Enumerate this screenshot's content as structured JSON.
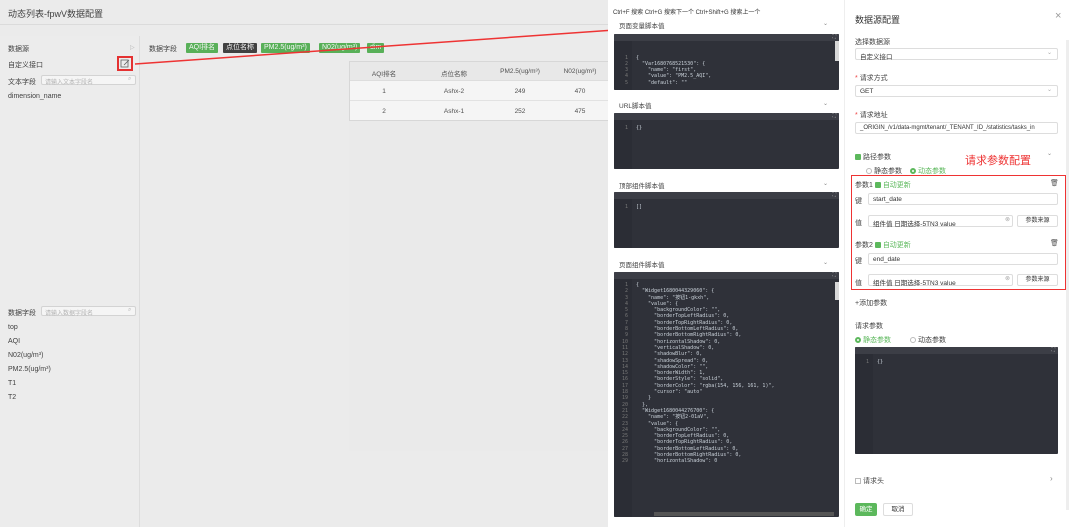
{
  "page": {
    "title": "动态列表-fpwV数据配置"
  },
  "left": {
    "datasource_label": "数据源",
    "datasource_value": "自定义接口",
    "text_field_label": "文本字段",
    "text_field_placeholder": "请输入文本字段名",
    "text_items": [
      "dimension_name"
    ],
    "data_field_label": "数据字段",
    "data_field_placeholder": "请输入数据字段名",
    "data_items": [
      "top",
      "AQI",
      "N02(ug/m³)",
      "PM2.5(ug/m³)",
      "T1",
      "T2"
    ]
  },
  "preview": {
    "data_field_label": "数据字段",
    "tags": [
      {
        "label": "AQI排名",
        "color": "#5cb85c"
      },
      {
        "label": "点位名称",
        "color": "#444444"
      },
      {
        "label": "PM2.5(ug/m³)",
        "color": "#5cb85c"
      },
      {
        "label": "N02(ug/m³)",
        "color": "#5cb85c"
      },
      {
        "label": "dim",
        "color": "#5cb85c"
      }
    ],
    "columns": [
      "AQI排名",
      "点位名称",
      "PM2.5(ug/m³)",
      "N02(ug/m³)"
    ],
    "rows": [
      [
        "1",
        "Ashx-2",
        "249",
        "470"
      ],
      [
        "2",
        "Ashx-1",
        "252",
        "475"
      ]
    ]
  },
  "middle": {
    "hint": "Ctrl+F 搜索 Ctrl+G 搜索下一个 Ctrl+Shift+G 搜索上一个",
    "sec1_title": "页面变量脚本值",
    "sec1_lines": [
      "1",
      "2",
      "3",
      "4",
      "5"
    ],
    "sec1_code": [
      "{",
      "  \"Var1680768521530\": {",
      "    \"name\": \"first\",",
      "    \"value\": \"PM2.5_AQI\",",
      "    \"default\": \"\""
    ],
    "sec2_title": "URL脚本值",
    "sec2_code": "{}",
    "sec3_title": "顶部组件脚本值",
    "sec3_code": "[]",
    "sec4_title": "页面组件脚本值",
    "sec4_code": [
      "{",
      "  \"Widget1680044329060\": {",
      "    \"name\": \"按钮1-gkxh\",",
      "    \"value\": {",
      "      \"backgroundColor\": \"\",",
      "      \"borderTopLeftRadius\": 0,",
      "      \"borderTopRightRadius\": 0,",
      "      \"borderBottomLeftRadius\": 0,",
      "      \"borderBottomRightRadius\": 0,",
      "      \"horizontalShadow\": 0,",
      "      \"verticalShadow\": 0,",
      "      \"shadowBlur\": 0,",
      "      \"shadowSpread\": 0,",
      "      \"shadowColor\": \"\",",
      "      \"borderWidth\": 1,",
      "      \"borderStyle\": \"solid\",",
      "      \"borderColor\": \"rgba(154, 156, 161, 1)\",",
      "      \"cursor\": \"auto\"",
      "    }",
      "  },",
      "  \"Widget1680044276700\": {",
      "    \"name\": \"按钮2-01aV\",",
      "    \"value\": {",
      "      \"backgroundColor\": \"\",",
      "      \"borderTopLeftRadius\": 0,",
      "      \"borderTopRightRadius\": 0,",
      "      \"borderBottomLeftRadius\": 0,",
      "      \"borderBottomRightRadius\": 0,",
      "      \"horizontalShadow\": 0"
    ]
  },
  "right": {
    "title": "数据源配置",
    "close": "×",
    "select_source_label": "选择数据源",
    "select_source_value": "自定义接口",
    "method_label": "请求方式",
    "method_value": "GET",
    "url_label": "请求地址",
    "url_value": "_ORIGIN_/v1/data-mgmt/tenant/_TENANT_ID_/statistics/tasks_in",
    "path_params_label": "路径参数",
    "static_param_label": "静态参数",
    "dynamic_param_label": "动态参数",
    "annotation": "请求参数配置",
    "param1_label": "参数1",
    "param2_label": "参数2",
    "auto_update_label": "自动更新",
    "key_label": "键",
    "value_label": "值",
    "param1_key": "start_date",
    "param2_key": "end_date",
    "param_value": "组件值 日期选择-5TN3 value",
    "param_source_button": "参数来源",
    "add_param": "+添加参数",
    "request_params_label": "请求参数",
    "req_static": "静态参数",
    "req_dynamic": "动态参数",
    "req_code": "{}",
    "request_header_label": "请求头",
    "confirm": "确定",
    "cancel": "取消"
  }
}
